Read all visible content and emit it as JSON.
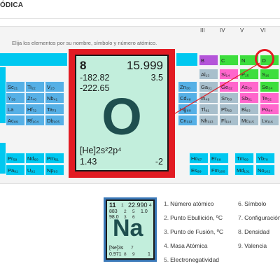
{
  "page": {
    "title": "ÓDICA"
  },
  "instruction": "Elija los elementos por su nombre, símbolo y número atómico.",
  "group_headers": [
    "III",
    "IV",
    "V",
    "VI"
  ],
  "cells": [
    {
      "name": "cell-b",
      "label": "B",
      "color": "purple"
    },
    {
      "name": "cell-c",
      "label": "C",
      "color": "green"
    },
    {
      "name": "cell-n",
      "label": "N",
      "color": "green"
    },
    {
      "name": "cell-o",
      "label": "O",
      "color": "green"
    },
    {
      "name": "cell-al",
      "label": "Al₁₃",
      "color": "gray"
    },
    {
      "name": "cell-si",
      "label": "Si₁₄",
      "color": "pink"
    },
    {
      "name": "cell-p",
      "label": "P₁₅",
      "color": "green"
    },
    {
      "name": "cell-s",
      "label": "S₁₆",
      "color": "green"
    },
    {
      "name": "cell-sc",
      "label": "Sc₂₁",
      "color": "lb"
    },
    {
      "name": "cell-ti",
      "label": "Ti₂₂",
      "color": "lb"
    },
    {
      "name": "cell-v",
      "label": "V₂₃",
      "color": "lb"
    },
    {
      "name": "cell-zn",
      "label": "Zn₃₀",
      "color": "lb"
    },
    {
      "name": "cell-ga",
      "label": "Ga₃₁",
      "color": "gray"
    },
    {
      "name": "cell-ge",
      "label": "Ge₃₂",
      "color": "pink"
    },
    {
      "name": "cell-as",
      "label": "As₃₃",
      "color": "pink"
    },
    {
      "name": "cell-se",
      "label": "Se₃₄",
      "color": "green"
    },
    {
      "name": "cell-y",
      "label": "Y₃₉",
      "color": "lb"
    },
    {
      "name": "cell-zr",
      "label": "Zr₄₀",
      "color": "lb"
    },
    {
      "name": "cell-nb",
      "label": "Nb₄₁",
      "color": "lb"
    },
    {
      "name": "cell-cd",
      "label": "Cd₄₈",
      "color": "lb"
    },
    {
      "name": "cell-in",
      "label": "In₄₉",
      "color": "gray"
    },
    {
      "name": "cell-sn",
      "label": "Sn₅₀",
      "color": "gray"
    },
    {
      "name": "cell-sb",
      "label": "Sb₅₁",
      "color": "pink"
    },
    {
      "name": "cell-te",
      "label": "Te₅₂",
      "color": "pink"
    },
    {
      "name": "cell-la",
      "label": "La",
      "color": "lb"
    },
    {
      "name": "cell-hf",
      "label": "Hf₇₂",
      "color": "lb"
    },
    {
      "name": "cell-ta",
      "label": "Ta₇₃",
      "color": "lb"
    },
    {
      "name": "cell-hg",
      "label": "Hg₈₀",
      "color": "lb"
    },
    {
      "name": "cell-tl",
      "label": "Tl₈₁",
      "color": "gray"
    },
    {
      "name": "cell-pb",
      "label": "Pb₈₂",
      "color": "gray"
    },
    {
      "name": "cell-bi",
      "label": "Bi₈₃",
      "color": "gray"
    },
    {
      "name": "cell-po",
      "label": "Po₈₄",
      "color": "pink"
    },
    {
      "name": "cell-ac",
      "label": "Ac₈₉",
      "color": "lb"
    },
    {
      "name": "cell-rf",
      "label": "Rf₁₀₄",
      "color": "lb"
    },
    {
      "name": "cell-db",
      "label": "Db₁₀₅",
      "color": "lb"
    },
    {
      "name": "cell-cn",
      "label": "Cn₁₁₂",
      "color": "lb"
    },
    {
      "name": "cell-nh",
      "label": "Nh₁₁₃",
      "color": "gray"
    },
    {
      "name": "cell-fl",
      "label": "Fl₁₁₄",
      "color": "gray"
    },
    {
      "name": "cell-mc",
      "label": "Mc₁₁₅",
      "color": "gray"
    },
    {
      "name": "cell-lv",
      "label": "Lv₁₁₆",
      "color": "gray"
    },
    {
      "name": "cell-pr",
      "label": "Pr₅₉",
      "color": "cyan"
    },
    {
      "name": "cell-nd",
      "label": "Nd₆₀",
      "color": "cyan"
    },
    {
      "name": "cell-pm",
      "label": "Pm₆₁",
      "color": "cyan"
    },
    {
      "name": "cell-ho",
      "label": "Ho₆₇",
      "color": "cyan"
    },
    {
      "name": "cell-er",
      "label": "Er₆₈",
      "color": "cyan"
    },
    {
      "name": "cell-tm",
      "label": "Tm₆₉",
      "color": "cyan"
    },
    {
      "name": "cell-yb",
      "label": "Yb₇₀",
      "color": "cyan"
    },
    {
      "name": "cell-pa",
      "label": "Pa₉₁",
      "color": "cyan"
    },
    {
      "name": "cell-u",
      "label": "U₉₂",
      "color": "cyan"
    },
    {
      "name": "cell-np",
      "label": "Np₉₃",
      "color": "cyan"
    },
    {
      "name": "cell-es",
      "label": "Es₉₉",
      "color": "cyan"
    },
    {
      "name": "cell-fm",
      "label": "Fm₁₀₀",
      "color": "cyan"
    },
    {
      "name": "cell-md",
      "label": "Md₁₀₁",
      "color": "cyan"
    },
    {
      "name": "cell-no",
      "label": "No₁₀₂",
      "color": "cyan"
    }
  ],
  "zoom": {
    "atomic_number": "8",
    "atomic_mass": "15.999",
    "boiling_point": "-182.82",
    "electronegativity": "3.5",
    "fusion_point": "-222.65",
    "symbol": "O",
    "configuration": "[He]2s²2p⁴",
    "density": "1.43",
    "valence": "-2"
  },
  "legend_card": {
    "atomic_number": "11",
    "atomic_mass": "22.990",
    "boiling_point": "883",
    "fusion_point": "98.0",
    "electronegativity": "1.0",
    "density": "0.971",
    "symbol": "Na",
    "configuration": "[Ne]3s",
    "valence": "1",
    "index_1": "1",
    "index_2": "2",
    "index_3": "3",
    "index_4": "4",
    "index_5": "5",
    "index_6": "6",
    "index_7": "7",
    "index_8": "8",
    "index_9": "9"
  },
  "legend_items": [
    {
      "num": "1.",
      "label": "Número atómico"
    },
    {
      "num": "2.",
      "label": "Punto Ebullición, ºC"
    },
    {
      "num": "3.",
      "label": "Punto de Fusión, ºC"
    },
    {
      "num": "4.",
      "label": "Masa Atómica"
    },
    {
      "num": "5.",
      "label": "Electronegatividad"
    },
    {
      "num": "6.",
      "label": "Símbolo"
    },
    {
      "num": "7.",
      "label": "Configuración"
    },
    {
      "num": "8.",
      "label": "Densidad"
    },
    {
      "num": "9.",
      "label": "Valencia"
    }
  ],
  "colors": {
    "cyan": "#00c8f0",
    "light_blue": "#56b0e6",
    "gray": "#a8bfcc",
    "green": "#3dde3d",
    "pink": "#ff66cc",
    "purple": "#b455d9",
    "highlight_red": "#e21b23",
    "card_bg": "#c2eedc"
  }
}
